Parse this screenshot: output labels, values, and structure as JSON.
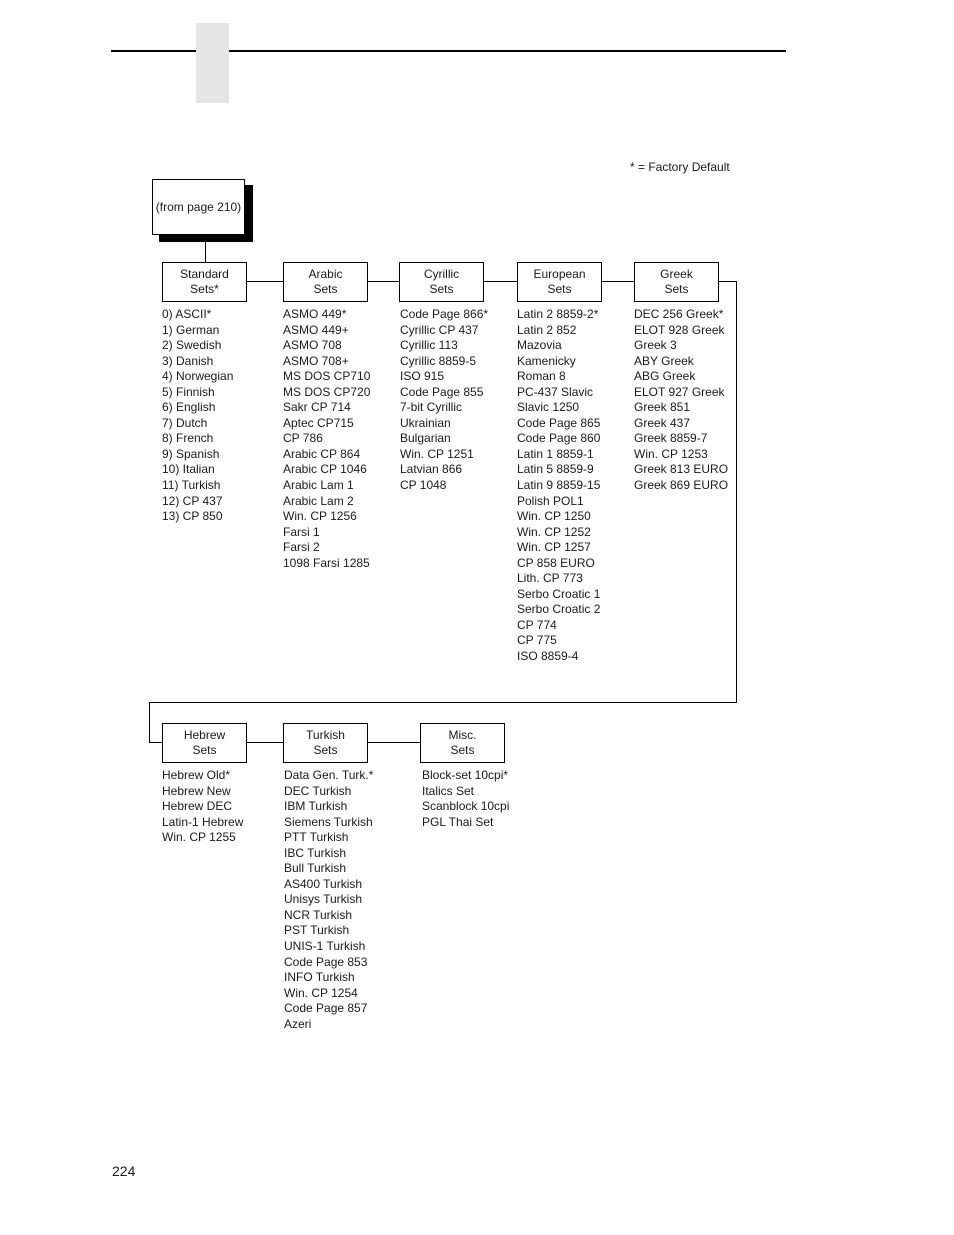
{
  "page": {
    "number": "224"
  },
  "legend": "* = Factory Default",
  "source_box": {
    "label": "(from page 210)"
  },
  "rows": [
    {
      "sets": [
        {
          "id": "standard",
          "title": [
            "Standard",
            "Sets*"
          ],
          "items": [
            "0) ASCII*",
            "1) German",
            "2) Swedish",
            "3) Danish",
            "4) Norwegian",
            "5) Finnish",
            "6) English",
            "7) Dutch",
            "8) French",
            "9) Spanish",
            "10) Italian",
            "11) Turkish",
            "12) CP 437",
            "13) CP 850"
          ]
        },
        {
          "id": "arabic",
          "title": [
            "Arabic",
            "Sets"
          ],
          "items": [
            "ASMO 449*",
            "ASMO 449+",
            "ASMO 708",
            "ASMO 708+",
            "MS DOS CP710",
            "MS DOS CP720",
            "Sakr CP 714",
            "Aptec CP715",
            "CP 786",
            "Arabic CP 864",
            "Arabic CP 1046",
            "Arabic Lam 1",
            "Arabic Lam 2",
            "Win. CP 1256",
            "Farsi 1",
            "Farsi 2",
            "1098 Farsi 1285"
          ]
        },
        {
          "id": "cyrillic",
          "title": [
            "Cyrillic",
            "Sets"
          ],
          "items": [
            "Code Page 866*",
            "Cyrillic CP 437",
            "Cyrillic 113",
            "Cyrillic 8859-5",
            "ISO 915",
            "Code Page 855",
            "7-bit Cyrillic",
            "Ukrainian",
            "Bulgarian",
            "Win. CP 1251",
            "Latvian 866",
            "CP 1048"
          ]
        },
        {
          "id": "european",
          "title": [
            "European",
            "Sets"
          ],
          "items": [
            "Latin 2 8859-2*",
            "Latin 2 852",
            "Mazovia",
            "Kamenicky",
            "Roman 8",
            "PC-437 Slavic",
            "Slavic 1250",
            "Code Page 865",
            "Code Page 860",
            "Latin 1 8859-1",
            "Latin 5 8859-9",
            "Latin 9 8859-15",
            "Polish POL1",
            "Win. CP 1250",
            "Win. CP 1252",
            "Win. CP 1257",
            "CP 858 EURO",
            "Lith. CP 773",
            "Serbo Croatic 1",
            "Serbo Croatic 2",
            "CP 774",
            "CP 775",
            "ISO 8859-4"
          ]
        },
        {
          "id": "greek",
          "title": [
            "Greek",
            "Sets"
          ],
          "items": [
            "DEC 256 Greek*",
            "ELOT 928 Greek",
            "Greek 3",
            "ABY Greek",
            "ABG Greek",
            "ELOT 927 Greek",
            "Greek 851",
            "Greek 437",
            "Greek 8859-7",
            "Win. CP 1253",
            "Greek 813 EURO",
            "Greek 869 EURO"
          ]
        }
      ]
    },
    {
      "sets": [
        {
          "id": "hebrew",
          "title": [
            "Hebrew",
            "Sets"
          ],
          "items": [
            "Hebrew Old*",
            "Hebrew New",
            "Hebrew DEC",
            "Latin-1 Hebrew",
            "Win. CP 1255"
          ]
        },
        {
          "id": "turkish",
          "title": [
            "Turkish",
            "Sets"
          ],
          "items": [
            "Data Gen. Turk.*",
            "DEC Turkish",
            "IBM Turkish",
            "Siemens Turkish",
            "PTT Turkish",
            "IBC Turkish",
            "Bull Turkish",
            "AS400 Turkish",
            "Unisys Turkish",
            "NCR Turkish",
            "PST Turkish",
            "UNIS-1 Turkish",
            "Code Page 853",
            "INFO Turkish",
            "Win. CP 1254",
            "Code Page 857",
            "Azeri"
          ]
        },
        {
          "id": "misc",
          "title": [
            "Misc.",
            "Sets"
          ],
          "items": [
            "Block-set 10cpi*",
            "Italics Set",
            "Scanblock 10cpi",
            "PGL Thai Set"
          ]
        }
      ]
    }
  ]
}
